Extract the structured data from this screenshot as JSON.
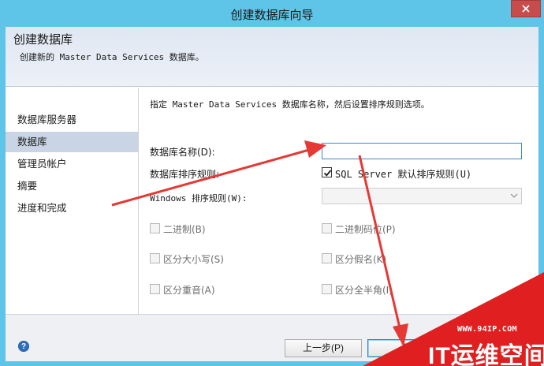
{
  "window": {
    "title": "创建数据库向导"
  },
  "header": {
    "title": "创建数据库",
    "subtitle": "创建新的 Master Data Services 数据库。"
  },
  "nav": {
    "items": [
      {
        "label": "数据库服务器",
        "active": false
      },
      {
        "label": "数据库",
        "active": true
      },
      {
        "label": "管理员帐户",
        "active": false
      },
      {
        "label": "摘要",
        "active": false
      },
      {
        "label": "进度和完成",
        "active": false
      }
    ]
  },
  "main": {
    "instruction": "指定 Master Data Services 数据库名称，然后设置排序规则选项。",
    "db_name_label": "数据库名称(D):",
    "db_name_value": "",
    "collation_label": "数据库排序规则:",
    "sql_default_label": "SQL Server 默认排序规则(U)",
    "sql_default_checked": true,
    "windows_collation_label": "Windows 排序规则(W):",
    "windows_collation_value": "",
    "options": [
      {
        "label": "二进制(B)",
        "checked": false
      },
      {
        "label": "二进制码位(P)",
        "checked": false
      },
      {
        "label": "区分大小写(S)",
        "checked": false
      },
      {
        "label": "区分假名(K)",
        "checked": false
      },
      {
        "label": "区分重音(A)",
        "checked": false
      },
      {
        "label": "区分全半角(I)",
        "checked": false
      }
    ]
  },
  "footer": {
    "help_glyph": "?",
    "back_label": "上一步(P)",
    "next_label": "下"
  },
  "watermark": {
    "url": "WWW.94IP.COM",
    "brand": "IT运维空间"
  },
  "colors": {
    "titlebar": "#5ec4e8",
    "close_button": "#c74d4d",
    "nav_active": "#c9d5e4",
    "annotation_arrow": "#e53935",
    "watermark_red": "#e02020"
  }
}
